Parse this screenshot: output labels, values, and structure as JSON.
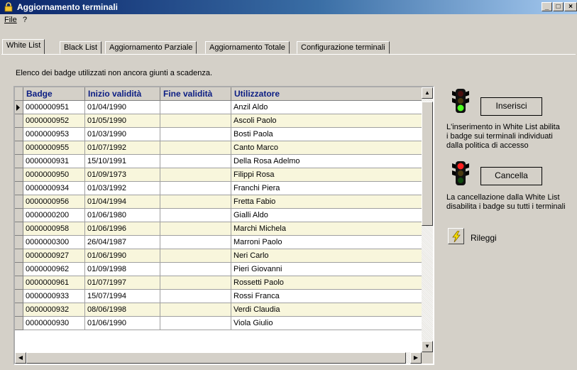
{
  "window": {
    "title": "Aggiornamento terminali",
    "min": "_",
    "max": "□",
    "close": "×"
  },
  "menu": {
    "file": "File",
    "help": "?"
  },
  "tabs": [
    "White List",
    "Black List",
    "Aggiornamento Parziale",
    "Aggiornamento Totale",
    "Configurazione terminali"
  ],
  "description": "Elenco dei badge utilizzati non ancora giunti a scadenza.",
  "table": {
    "headers": [
      "Badge",
      "Inizio validità",
      "Fine validità",
      "Utilizzatore"
    ],
    "rows": [
      [
        "0000000951",
        "01/04/1990",
        "",
        "Anzil Aldo"
      ],
      [
        "0000000952",
        "01/05/1990",
        "",
        "Ascoli Paolo"
      ],
      [
        "0000000953",
        "01/03/1990",
        "",
        "Bosti Paola"
      ],
      [
        "0000000955",
        "01/07/1992",
        "",
        "Canto Marco"
      ],
      [
        "0000000931",
        "15/10/1991",
        "",
        "Della Rosa Adelmo"
      ],
      [
        "0000000950",
        "01/09/1973",
        "",
        "Filippi Rosa"
      ],
      [
        "0000000934",
        "01/03/1992",
        "",
        "Franchi Piera"
      ],
      [
        "0000000956",
        "01/04/1994",
        "",
        "Fretta Fabio"
      ],
      [
        "0000000200",
        "01/06/1980",
        "",
        "Gialli Aldo"
      ],
      [
        "0000000958",
        "01/06/1996",
        "",
        "Marchi Michela"
      ],
      [
        "0000000300",
        "26/04/1987",
        "",
        "Marroni Paolo"
      ],
      [
        "0000000927",
        "01/06/1990",
        "",
        "Neri Carlo"
      ],
      [
        "0000000962",
        "01/09/1998",
        "",
        "Pieri Giovanni"
      ],
      [
        "0000000961",
        "01/07/1997",
        "",
        "Rossetti Paolo"
      ],
      [
        "0000000933",
        "15/07/1994",
        "",
        "Rossi Franca"
      ],
      [
        "0000000932",
        "08/06/1998",
        "",
        "Verdi Claudia"
      ],
      [
        "0000000930",
        "01/06/1990",
        "",
        "Viola Giulio"
      ]
    ]
  },
  "actions": {
    "insert_label": "Inserisci",
    "insert_note": [
      "L'inserimento in White List abilita",
      "i badge sui terminali individuati",
      "dalla politica di accesso"
    ],
    "delete_label": "Cancella",
    "delete_note": [
      "La cancellazione dalla White List",
      "disabilita i badge su tutti i terminali"
    ],
    "reload_label": "Rileggi"
  },
  "colors": {
    "row_alt": "#f8f6dc",
    "header_text": "#0b1d83",
    "title_bar": "#0a246a"
  },
  "icons": {
    "title": "lock-icon",
    "green_light": "traffic-light-green-icon",
    "red_light": "traffic-light-red-icon",
    "reload": "lightning-icon"
  }
}
